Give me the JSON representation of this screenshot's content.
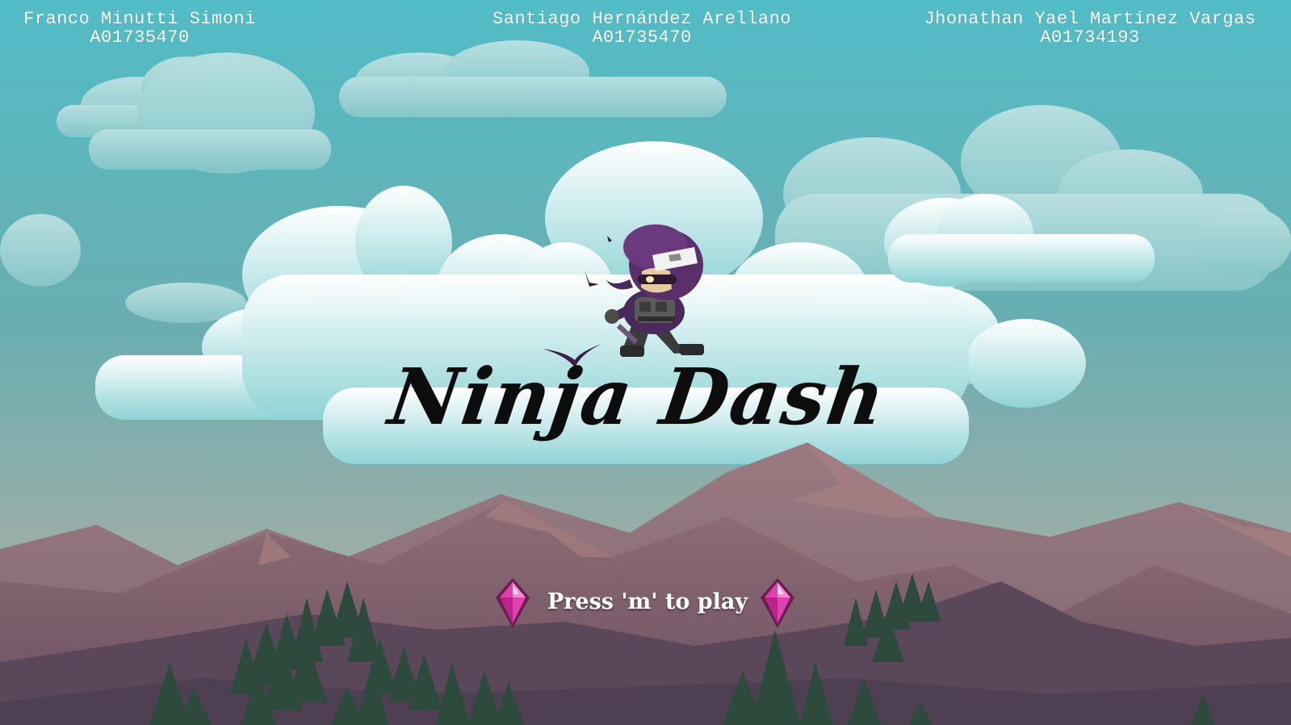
{
  "credits": [
    {
      "name": "Franco Minutti Simoni",
      "id": "A01735470"
    },
    {
      "name": "Santiago Hernández Arellano",
      "id": "A01735470"
    },
    {
      "name": "Jhonathan Yael Martínez Vargas",
      "id": "A01734193"
    }
  ],
  "game": {
    "title": "Ninja Dash",
    "prompt": "Press 'm' to play"
  },
  "icons": {
    "character": "ninja-character-icon",
    "gem": "pink-gem-icon",
    "bird": "bird-icon"
  },
  "colors": {
    "sky_top": "#5bbfc8",
    "sky_bottom": "#9fb1aa",
    "cloud": "#e6f5f5",
    "mountain": "#8a6878",
    "mountain_dark": "#5a4a5e",
    "tree": "#2f4a3e",
    "gem": "#e040b0",
    "title": "#0d0d0d",
    "prompt": "#ffffff"
  }
}
